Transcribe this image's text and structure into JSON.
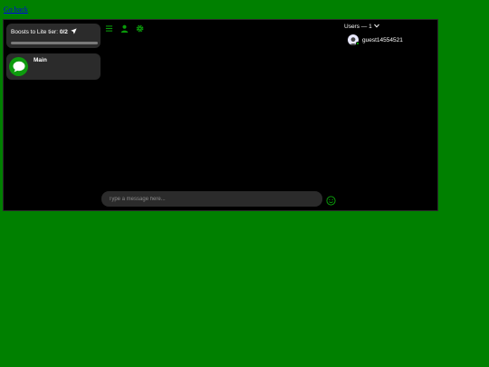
{
  "nav": {
    "go_back": "Go back"
  },
  "boost": {
    "prefix": "Boosts to Lite tier: ",
    "count": "0/2",
    "progress": 0
  },
  "channels": [
    {
      "name": "Main"
    }
  ],
  "toolbar": {
    "icons": [
      "menu-icon",
      "user-icon",
      "gear-icon"
    ]
  },
  "composer": {
    "placeholder": "Type a message here..."
  },
  "users": {
    "header": "Users — 1",
    "list": [
      {
        "name": "guest14554521",
        "status": "online"
      }
    ]
  },
  "colors": {
    "page_bg": "#008000",
    "accent": "#0a9a0a",
    "panel": "#2b2b2b",
    "online": "#00cc00"
  }
}
